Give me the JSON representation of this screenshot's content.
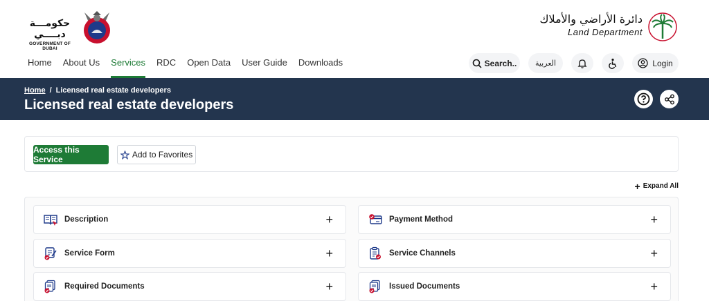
{
  "header": {
    "gov_logo_ar": "حكومـــة دبــــي",
    "gov_logo_en": "GOVERNMENT OF DUBAI",
    "dld_logo_ar": "دائرة الأراضي والأملاك",
    "dld_logo_en": "Land Department"
  },
  "nav": {
    "items": [
      "Home",
      "About Us",
      "Services",
      "RDC",
      "Open Data",
      "User Guide",
      "Downloads"
    ],
    "active": "Services"
  },
  "actions": {
    "search_label": "Search..",
    "arabic_label": "العربية",
    "login_label": "Login"
  },
  "breadcrumb": {
    "home": "Home",
    "separator": "/",
    "current": "Licensed real estate developers"
  },
  "page": {
    "title": "Licensed real estate developers"
  },
  "service_actions": {
    "access_label": "Access this Service",
    "favorites_label": "Add to Favorites"
  },
  "accordion": {
    "expand_all_label": "Expand All",
    "left": [
      "Description",
      "Service Form",
      "Required Documents"
    ],
    "right": [
      "Payment Method",
      "Service Channels",
      "Issued Documents"
    ]
  },
  "colors": {
    "accent_green": "#1e7b36",
    "hero_navy": "#23354e",
    "icon_red": "#c8102e",
    "icon_blue": "#1e3a8a"
  }
}
